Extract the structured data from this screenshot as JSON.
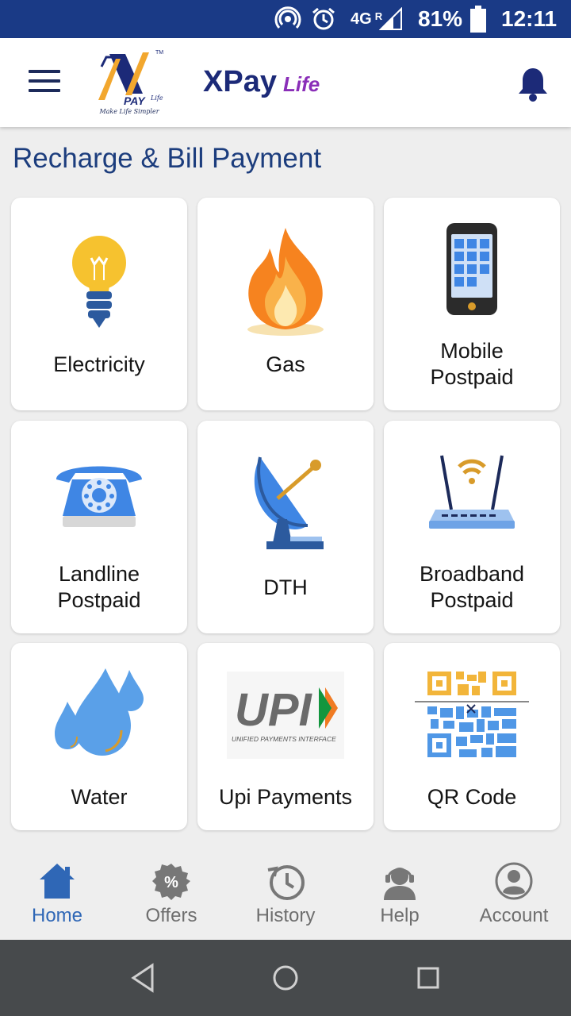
{
  "status_bar": {
    "network": "4G",
    "roaming": "R",
    "battery": "81%",
    "time": "12:11"
  },
  "app_bar": {
    "logo_text": "PAY",
    "logo_script": "Life",
    "logo_tagline": "Make Life Simpler",
    "brand_title": "XPay",
    "brand_sub": "Life"
  },
  "section": {
    "title": "Recharge & Bill Payment"
  },
  "services": {
    "electricity": "Electricity",
    "gas": "Gas",
    "mobile_line1": "Mobile",
    "mobile_line2": "Postpaid",
    "landline_line1": "Landline",
    "landline_line2": "Postpaid",
    "dth": "DTH",
    "broadband_line1": "Broadband",
    "broadband_line2": "Postpaid",
    "water": "Water",
    "upi": "Upi Payments",
    "upi_logo": "UPI",
    "upi_sub": "UNIFIED PAYMENTS INTERFACE",
    "qr": "QR Code"
  },
  "bottom_nav": {
    "home": "Home",
    "offers": "Offers",
    "offers_badge": "%",
    "history": "History",
    "help": "Help",
    "account": "Account"
  },
  "colors": {
    "primary": "#1a3a86",
    "active_nav": "#2f67b6",
    "title": "#1c3d7d"
  }
}
